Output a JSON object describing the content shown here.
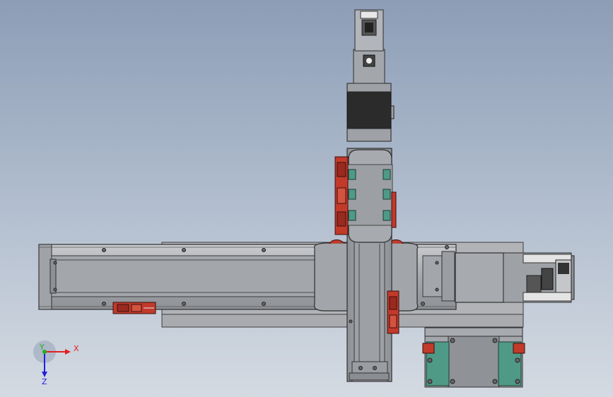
{
  "viewport": {
    "background_top": "#8c9db6",
    "background_bottom": "#d4dae2"
  },
  "model": {
    "x_axis_module": "horizontal-linear-actuator",
    "y_axis_module": "vertical-linear-actuator",
    "motors": [
      "x-axis-stepper-motor",
      "y-axis-stepper-motor"
    ],
    "accent_colors": {
      "sensor_red": "#c23a2a",
      "slider_teal": "#4f9a86",
      "motor_black": "#2b2b2b",
      "rail_gray": "#a7a9ad"
    }
  },
  "triad": {
    "x_label": "X",
    "y_label": "Y",
    "z_label": "Z",
    "x_color": "#e02020",
    "y_color": "#20b020",
    "z_color": "#2020e0"
  }
}
